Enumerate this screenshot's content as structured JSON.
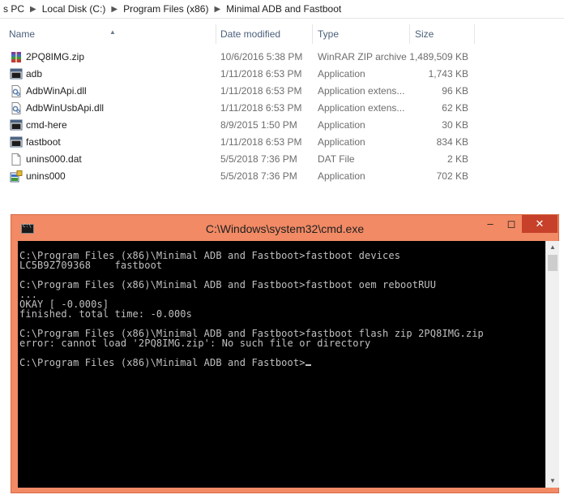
{
  "breadcrumb": [
    "s PC",
    "Local Disk (C:)",
    "Program Files (x86)",
    "Minimal ADB and Fastboot"
  ],
  "columns": {
    "name": "Name",
    "date": "Date modified",
    "type": "Type",
    "size": "Size"
  },
  "files": [
    {
      "name": "2PQ8IMG.zip",
      "date": "10/6/2016 5:38 PM",
      "type": "WinRAR ZIP archive",
      "size": "1,489,509 KB",
      "icon": "winrar-archive-icon"
    },
    {
      "name": "adb",
      "date": "1/11/2018 6:53 PM",
      "type": "Application",
      "size": "1,743 KB",
      "icon": "console-app-icon"
    },
    {
      "name": "AdbWinApi.dll",
      "date": "1/11/2018 6:53 PM",
      "type": "Application extens...",
      "size": "96 KB",
      "icon": "dll-file-icon"
    },
    {
      "name": "AdbWinUsbApi.dll",
      "date": "1/11/2018 6:53 PM",
      "type": "Application extens...",
      "size": "62 KB",
      "icon": "dll-file-icon"
    },
    {
      "name": "cmd-here",
      "date": "8/9/2015 1:50 PM",
      "type": "Application",
      "size": "30 KB",
      "icon": "console-app-icon"
    },
    {
      "name": "fastboot",
      "date": "1/11/2018 6:53 PM",
      "type": "Application",
      "size": "834 KB",
      "icon": "console-app-icon"
    },
    {
      "name": "unins000.dat",
      "date": "5/5/2018 7:36 PM",
      "type": "DAT File",
      "size": "2 KB",
      "icon": "blank-file-icon"
    },
    {
      "name": "unins000",
      "date": "5/5/2018 7:36 PM",
      "type": "Application",
      "size": "702 KB",
      "icon": "installer-app-icon"
    }
  ],
  "cmd": {
    "title": "C:\\Windows\\system32\\cmd.exe",
    "output": "C:\\Program Files (x86)\\Minimal ADB and Fastboot>fastboot devices\nLC5B9Z709368    fastboot\n\nC:\\Program Files (x86)\\Minimal ADB and Fastboot>fastboot oem rebootRUU\n...\nOKAY [ -0.000s]\nfinished. total time: -0.000s\n\nC:\\Program Files (x86)\\Minimal ADB and Fastboot>fastboot flash zip 2PQ8IMG.zip\nerror: cannot load '2PQ8IMG.zip': No such file or directory\n\nC:\\Program Files (x86)\\Minimal ADB and Fastboot>",
    "close_color": "#c7402a",
    "frame_color": "#f18a65"
  }
}
